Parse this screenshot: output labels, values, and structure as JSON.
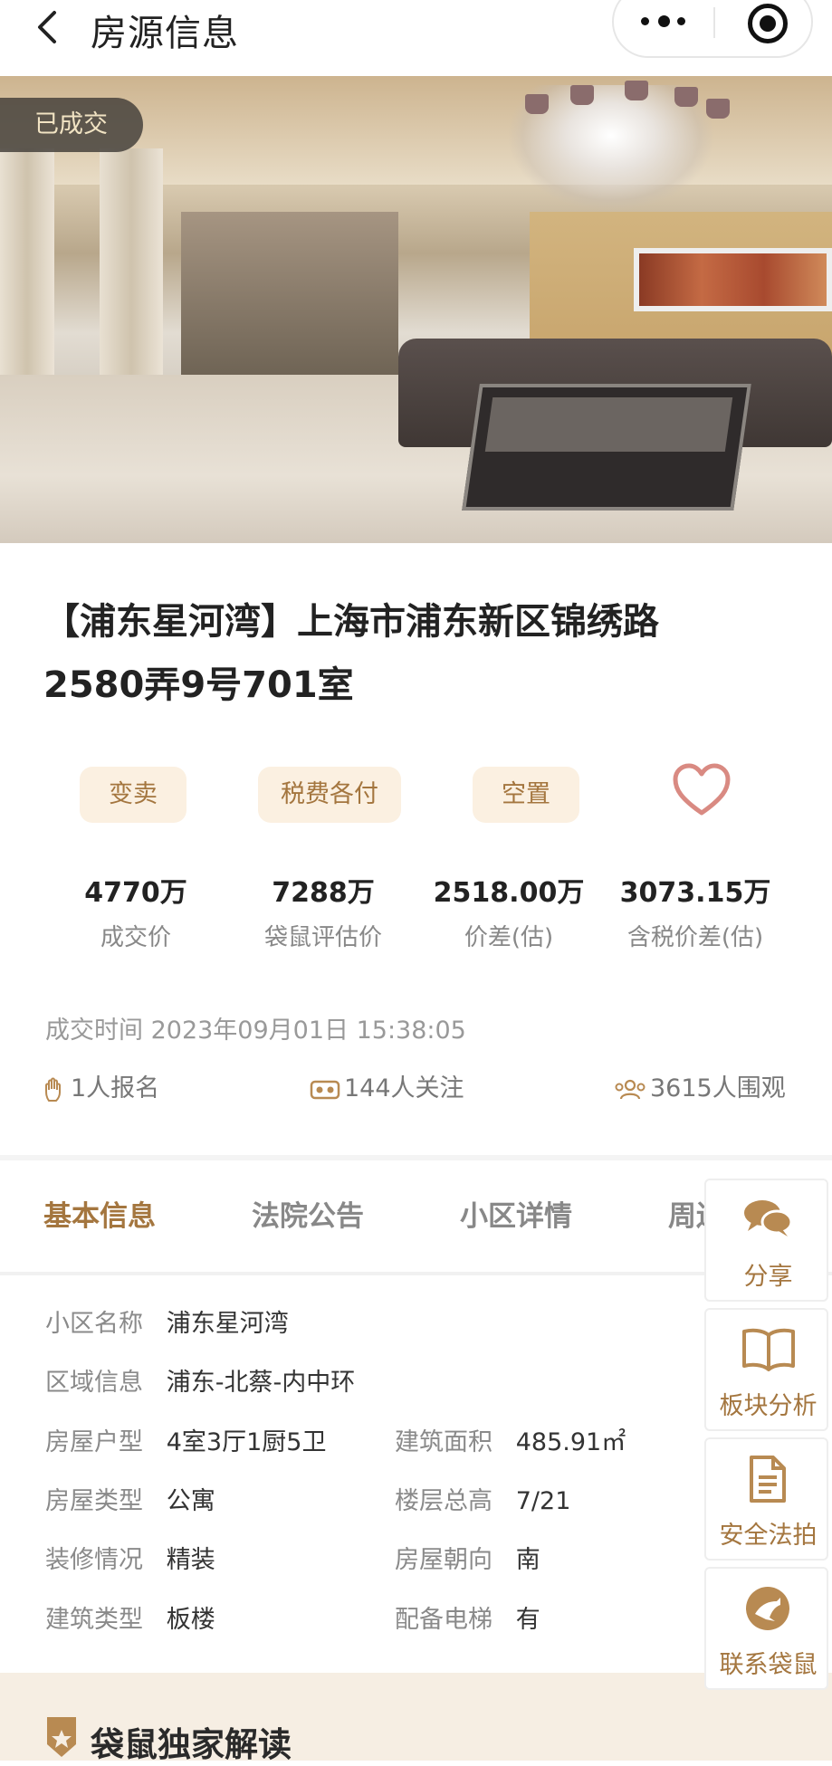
{
  "navbar": {
    "title": "房源信息"
  },
  "hero": {
    "badge": "已成交"
  },
  "listing": {
    "title_line1": "【浦东星河湾】上海市浦东新区锦绣路",
    "title_line2": "2580弄9号701室",
    "tags": [
      "变卖",
      "税费各付",
      "空置"
    ]
  },
  "stats": [
    {
      "value": "4770万",
      "label": "成交价"
    },
    {
      "value": "7288万",
      "label": "袋鼠评估价"
    },
    {
      "value": "2518.00万",
      "label": "价差(估)"
    },
    {
      "value": "3073.15万",
      "label": "含税价差(估)"
    }
  ],
  "deal_time": "成交时间 2023年09月01日 15:38:05",
  "meta": {
    "signups": "1人报名",
    "followers": "144人关注",
    "viewers": "3615人围观"
  },
  "tabs": [
    "基本信息",
    "法院公告",
    "小区详情",
    "周边"
  ],
  "info": {
    "community_k": "小区名称",
    "community_v": "浦东星河湾",
    "area_k": "区域信息",
    "area_v": "浦东-北蔡-内中环",
    "layout_k": "房屋户型",
    "layout_v": "4室3厅1厨5卫",
    "build_area_k": "建筑面积",
    "build_area_v": "485.91㎡",
    "type_k": "房屋类型",
    "type_v": "公寓",
    "floor_k": "楼层总高",
    "floor_v": "7/21",
    "deco_k": "装修情况",
    "deco_v": "精装",
    "facing_k": "房屋朝向",
    "facing_v": "南",
    "btype_k": "建筑类型",
    "btype_v": "板楼",
    "elevator_k": "配备电梯",
    "elevator_v": "有"
  },
  "side_buttons": [
    {
      "label": "分享",
      "icon": "chat-icon"
    },
    {
      "label": "板块分析",
      "icon": "book-icon"
    },
    {
      "label": "安全法拍",
      "icon": "document-icon"
    },
    {
      "label": "联系袋鼠",
      "icon": "kangaroo-logo-icon"
    }
  ],
  "bottom": {
    "title": "袋鼠独家解读"
  },
  "colors": {
    "accent": "#a4763f",
    "tag_bg": "#fbf0e1",
    "heart": "#d98a82"
  }
}
